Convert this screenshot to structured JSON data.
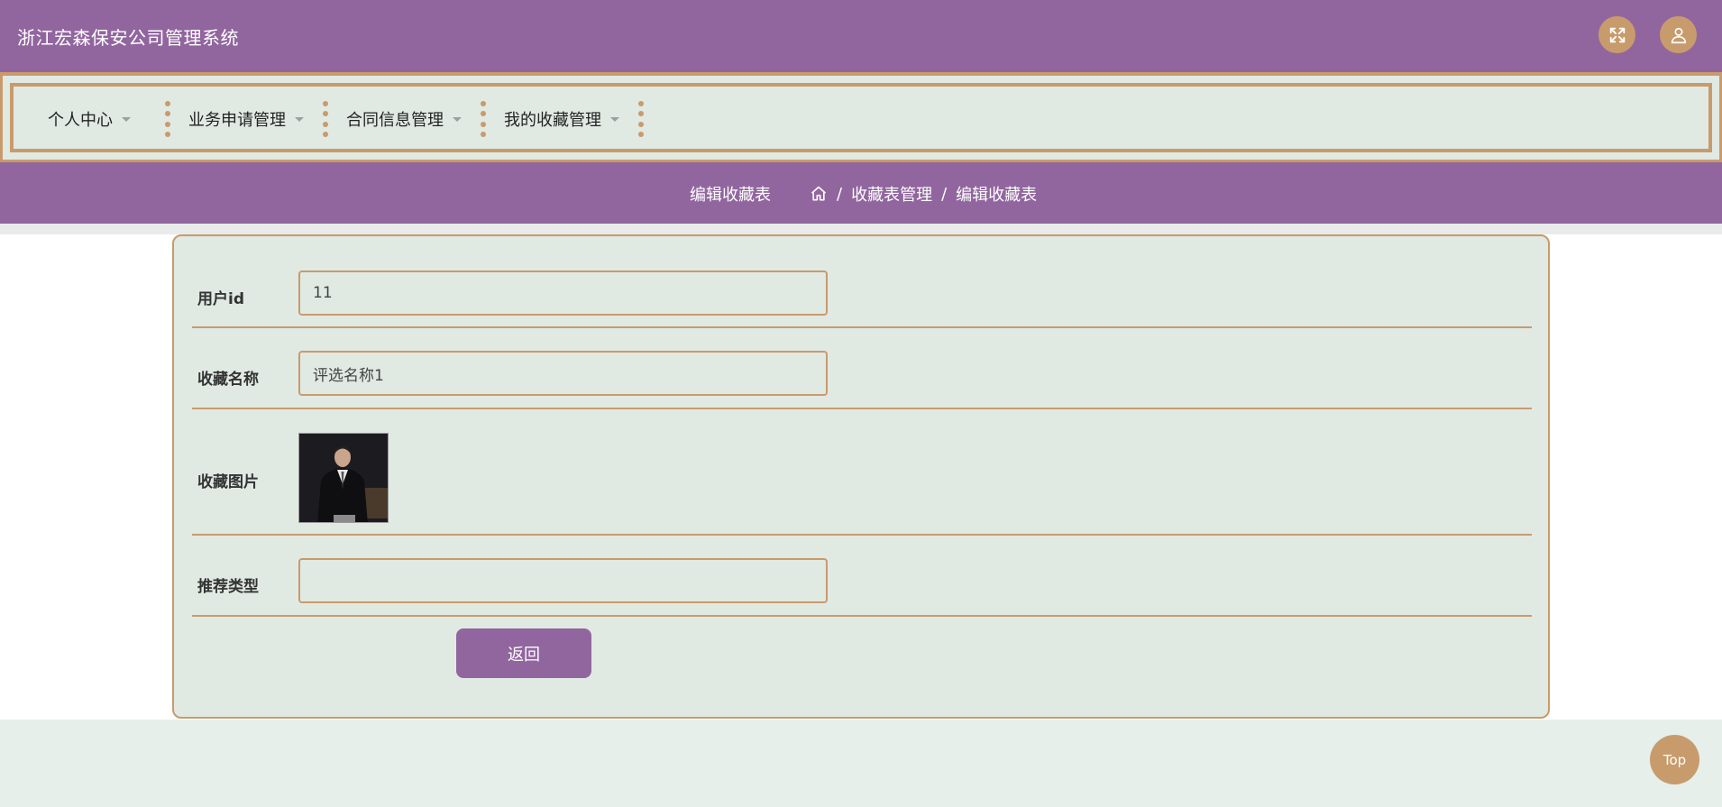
{
  "app": {
    "title": "浙江宏森保安公司管理系统"
  },
  "header": {
    "fullscreen_icon": "expand-arrows-icon",
    "user_icon": "user-icon"
  },
  "nav": {
    "items": [
      {
        "label": "个人中心"
      },
      {
        "label": "业务申请管理"
      },
      {
        "label": "合同信息管理"
      },
      {
        "label": "我的收藏管理"
      }
    ]
  },
  "breadcrumb": {
    "page_title": "编辑收藏表",
    "home_icon": "home-icon",
    "separator": "/",
    "items": [
      "收藏表管理",
      "编辑收藏表"
    ]
  },
  "form": {
    "fields": [
      {
        "label": "用户id",
        "value": "11"
      },
      {
        "label": "收藏名称",
        "value": "评选名称1"
      },
      {
        "label": "收藏图片"
      },
      {
        "label": "推荐类型",
        "value": ""
      }
    ],
    "back_label": "返回"
  },
  "scroll_top": {
    "label": "Top"
  },
  "colors": {
    "primary": "#91669f",
    "accent": "#c89b6c",
    "panel_bg": "#e1e9e3",
    "page_bg": "#e6efea"
  }
}
